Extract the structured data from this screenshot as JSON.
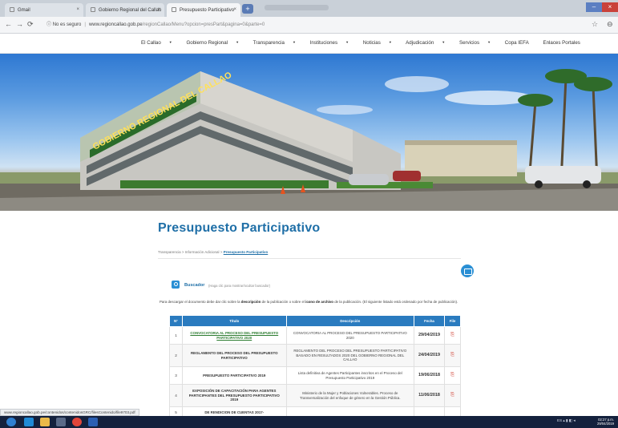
{
  "browser": {
    "tabs": [
      {
        "label": "Gmail"
      },
      {
        "label": "Gobierno Regional del Callao"
      },
      {
        "label": "Presupuesto Participativo"
      }
    ],
    "new_tab_label": "+",
    "security_label": "No es seguro",
    "url_host": "www.regioncallao.gob.pe",
    "url_path": "/regionCallao/Menu?opcion=presPart&pagina=0&parte=0"
  },
  "site_nav": {
    "items": [
      {
        "label": "El Callao",
        "dropdown": true
      },
      {
        "label": "Gobierno Regional",
        "dropdown": true
      },
      {
        "label": "Transparencia",
        "dropdown": true
      },
      {
        "label": "Instituciones",
        "dropdown": true
      },
      {
        "label": "Noticias",
        "dropdown": true
      },
      {
        "label": "Adjudicación",
        "dropdown": true
      },
      {
        "label": "Servicios",
        "dropdown": true
      },
      {
        "label": "Copa IEFA",
        "dropdown": false
      },
      {
        "label": "Enlaces Portales",
        "dropdown": false
      }
    ]
  },
  "hero": {
    "sign_text": "GOBIERNO REGIONAL DEL CALLAO"
  },
  "page": {
    "title": "Presupuesto Participativo",
    "breadcrumb": {
      "items": [
        "Transparencia",
        "Información Adicional"
      ],
      "current": "Presupuesto Participativo",
      "separator": ">"
    },
    "search": {
      "label": "Buscador",
      "hint": "(Haga clic para mostrar/ocultar buscador)"
    },
    "instructions": {
      "prefix": "Para descargar el documento debe dar clic sobre la ",
      "bold1": "descripción",
      "middle": " de la publicación o sobre el ",
      "bold2": "icono de archivo",
      "suffix": " de la publicación. (El siguiente listado está ordenado por fecha de publicación)."
    }
  },
  "table": {
    "headers": {
      "num": "N°",
      "title": "Título",
      "description": "Descripción",
      "date": "Fecha",
      "file": "File"
    },
    "rows": [
      {
        "num": "1",
        "title": "CONVOCATORIA AL PROCESO DEL PRESUPUESTO PARTICIPATIVO 2020",
        "description": "CONVOCATORIA AL PROCESO DEL PRESUPUESTO PARTICIPATIVO 2020",
        "date": "29/04/2019",
        "link": true
      },
      {
        "num": "2",
        "title": "REGLAMENTO DEL PROCESO DEL PRESUPUESTO PARTICIPATIVO",
        "description": "REGLAMENTO DEL PROCESO DEL PRESUPUESTO PARTICIPATIVO BASADO EN RESULTADOS 2020 DEL GOBIERNO REGIONAL DEL CALLAO",
        "date": "24/04/2019",
        "link": false
      },
      {
        "num": "3",
        "title": "PRESUPUESTO PARTICIPATIVO 2019",
        "description": "Lista definitiva de Agentes Participantes inscritos en el Proceso del Presupuesto Participativo 2019",
        "date": "19/06/2018",
        "link": false
      },
      {
        "num": "4",
        "title": "EXPOSICIÓN DE CAPACITACIÓN PARA AGENTES PARTICIPANTES DEL PRESUPUESTO PARTICIPATIVO 2019",
        "description": "Ministerio de la Mujer y Poblaciones Vulnerables. Proceso de Transversalización del enfoque de género en la Gestión Pública.",
        "date": "11/06/2018",
        "link": false
      },
      {
        "num": "5",
        "title": "DE RENDICION DE CUENTAS 2017-",
        "description": "",
        "date": "",
        "link": false
      }
    ]
  },
  "status_bar": {
    "url": "www.regioncallao.gob.pe/contenidos/contenidosGRC/filesContenido/file9703.pdf"
  },
  "taskbar": {
    "tray_lang": "ES",
    "time": "02:27 p.m.",
    "date": "29/04/2019"
  }
}
